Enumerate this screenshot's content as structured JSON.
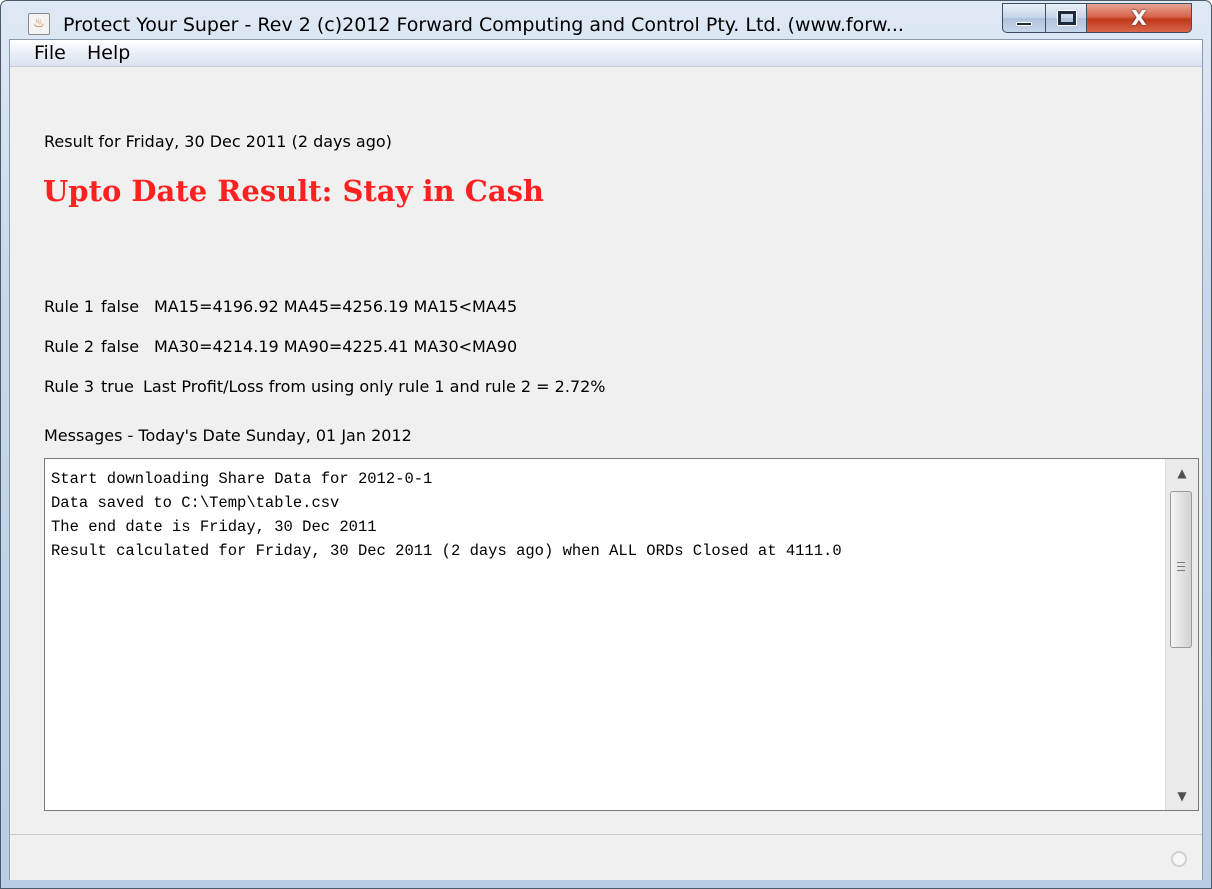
{
  "window": {
    "title": "Protect Your Super - Rev 2 (c)2012 Forward Computing and Control Pty. Ltd. (www.forw...",
    "icon": "java-cup-icon",
    "close_glyph": "X"
  },
  "menu": {
    "items": [
      {
        "label": "File"
      },
      {
        "label": "Help"
      }
    ]
  },
  "result": {
    "date_line": "Result for Friday, 30 Dec 2011 (2 days ago)",
    "headline": "Upto Date Result: Stay in Cash",
    "headline_color": "#ff2020"
  },
  "rules": [
    {
      "name": "Rule 1",
      "flag": "false",
      "detail": "MA15=4196.92 MA45=4256.19  MA15<MA45"
    },
    {
      "name": "Rule 2",
      "flag": "false",
      "detail": "MA30=4214.19 MA90=4225.41  MA30<MA90"
    },
    {
      "name": "Rule 3",
      "flag": "true",
      "detail": "Last Profit/Loss from using only rule 1 and rule 2  =  2.72%"
    }
  ],
  "messages": {
    "label": "Messages - Today's Date Sunday, 01 Jan 2012",
    "lines": [
      "Start downloading Share Data for 2012-0-1",
      "Data saved to C:\\Temp\\table.csv",
      "The end date is Friday, 30 Dec 2011",
      "Result calculated for Friday, 30 Dec 2011 (2 days ago) when ALL ORDs Closed at 4111.0"
    ]
  },
  "scrollbar": {
    "up_glyph": "▲",
    "down_glyph": "▼"
  }
}
